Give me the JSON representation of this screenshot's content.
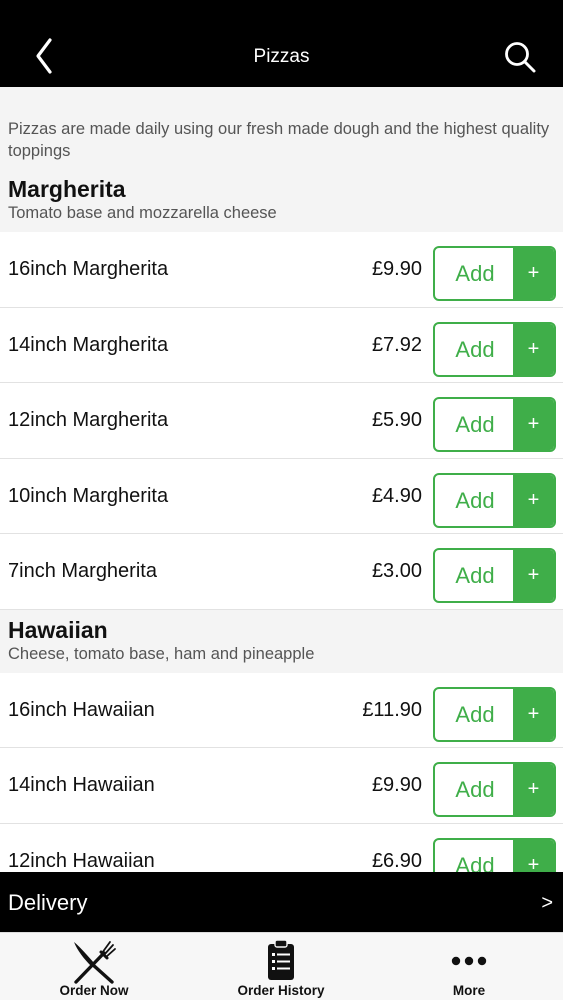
{
  "header": {
    "title": "Pizzas",
    "back_icon": "chevron-left-icon",
    "search_icon": "search-icon"
  },
  "intro": "Pizzas are made daily using our fresh made dough and the highest quality toppings",
  "categories": [
    {
      "title": "Margherita",
      "description": "Tomato base and mozzarella cheese",
      "items": [
        {
          "name": "16inch Margherita",
          "price": "£9.90",
          "add_label": "Add",
          "plus": "+"
        },
        {
          "name": "14inch Margherita",
          "price": "£7.92",
          "add_label": "Add",
          "plus": "+"
        },
        {
          "name": "12inch Margherita",
          "price": "£5.90",
          "add_label": "Add",
          "plus": "+"
        },
        {
          "name": "10inch Margherita",
          "price": "£4.90",
          "add_label": "Add",
          "plus": "+"
        },
        {
          "name": "7inch Margherita",
          "price": "£3.00",
          "add_label": "Add",
          "plus": "+"
        }
      ]
    },
    {
      "title": "Hawaiian",
      "description": "Cheese, tomato base, ham and pineapple",
      "items": [
        {
          "name": "16inch Hawaiian",
          "price": "£11.90",
          "add_label": "Add",
          "plus": "+"
        },
        {
          "name": "14inch Hawaiian",
          "price": "£9.90",
          "add_label": "Add",
          "plus": "+"
        },
        {
          "name": "12inch Hawaiian",
          "price": "£6.90",
          "add_label": "Add",
          "plus": "+"
        }
      ]
    }
  ],
  "delivery": {
    "label": "Delivery",
    "arrow": ">"
  },
  "tabs": [
    {
      "label": "Order Now",
      "icon": "fork-knife-icon"
    },
    {
      "label": "Order History",
      "icon": "clipboard-list-icon"
    },
    {
      "label": "More",
      "icon": "more-dots-icon"
    }
  ],
  "colors": {
    "accent": "#3fae49",
    "topbar": "#000000",
    "background": "#f4f4f4"
  }
}
